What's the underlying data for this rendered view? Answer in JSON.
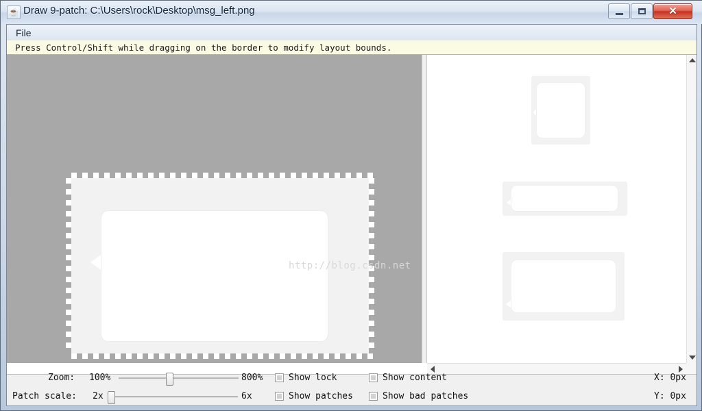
{
  "window": {
    "title": "Draw 9-patch: C:\\Users\\rock\\Desktop\\msg_left.png",
    "icon": "java-coffee-cup-icon",
    "controls": {
      "minimize": "–",
      "maximize": "□",
      "close": "✕"
    }
  },
  "menubar": {
    "items": [
      {
        "label": "File"
      }
    ]
  },
  "infobar": {
    "text": "Press Control/Shift while dragging on the border to modify layout bounds."
  },
  "editor": {
    "watermark": "http://blog.csdn.net"
  },
  "controls": {
    "zoom": {
      "label": "Zoom:",
      "min_label": "100%",
      "max_label": "800%",
      "value_percent": 42
    },
    "patch_scale": {
      "label": "Patch scale:",
      "min_label": "2x",
      "max_label": "6x",
      "value_percent": 0
    },
    "checkboxes": [
      {
        "label": "Show lock",
        "checked": false
      },
      {
        "label": "Show patches",
        "checked": false
      },
      {
        "label": "Show content",
        "checked": false
      },
      {
        "label": "Show bad patches",
        "checked": false
      }
    ],
    "coordinates": {
      "x": "X: 0px",
      "y": "Y: 0px"
    }
  },
  "colors": {
    "canvas_background": "#a8a8a8",
    "infobar_background": "#fbfbe4",
    "panel_background": "#f0f0f0",
    "patch_fill": "#f2f2f2",
    "content_fill": "#ffffff",
    "close_button": "#c3331f"
  }
}
